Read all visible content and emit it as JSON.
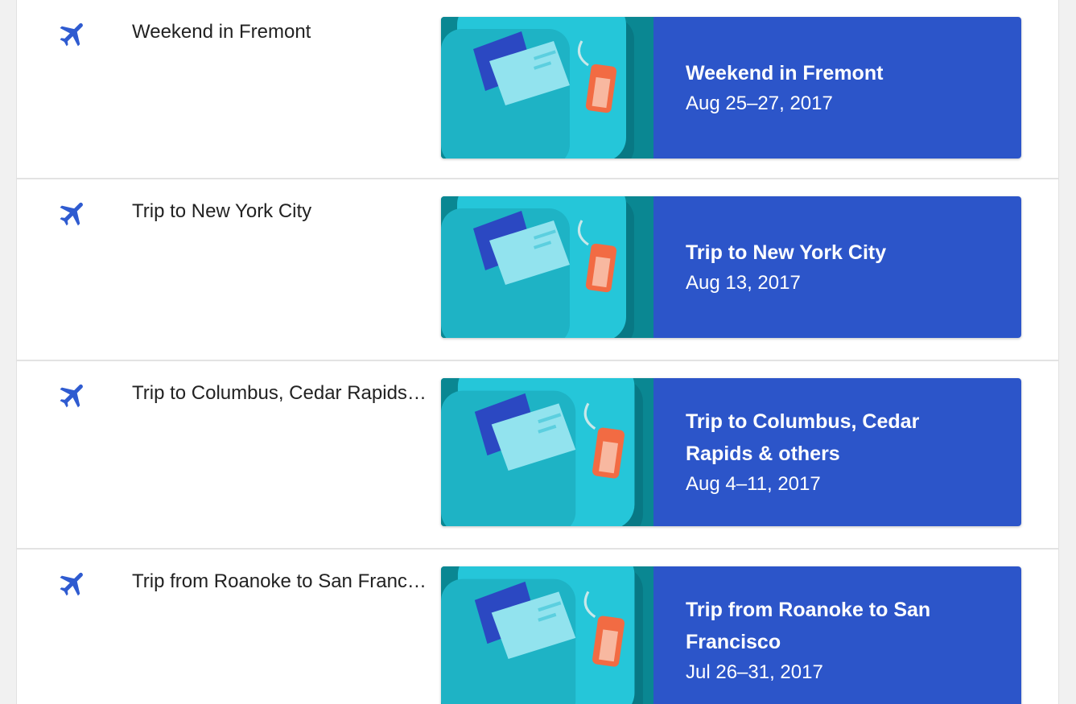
{
  "colors": {
    "accent": "#2c55c9",
    "card_info_bg": "#2c55c9",
    "plane_icon": "#2f5bd0",
    "art_teal_dark": "#0a8792",
    "art_teal_light": "#25c6d9",
    "tag_orange": "#f26b43"
  },
  "trips": [
    {
      "icon": "airplane-icon",
      "list_title": "Weekend in Fremont",
      "card_title": "Weekend in Fremont",
      "card_dates": "Aug 25–27, 2017"
    },
    {
      "icon": "airplane-icon",
      "list_title": "Trip to New York City",
      "card_title": "Trip to New York City",
      "card_dates": "Aug 13, 2017"
    },
    {
      "icon": "airplane-icon",
      "list_title": "Trip to Columbus, Cedar Rapids & others",
      "card_title": "Trip to Columbus, Cedar Rapids & others",
      "card_dates": "Aug 4–11, 2017"
    },
    {
      "icon": "airplane-icon",
      "list_title": "Trip from Roanoke to San Francisco",
      "card_title": "Trip from Roanoke to San Francisco",
      "card_dates": "Jul 26–31, 2017"
    }
  ]
}
